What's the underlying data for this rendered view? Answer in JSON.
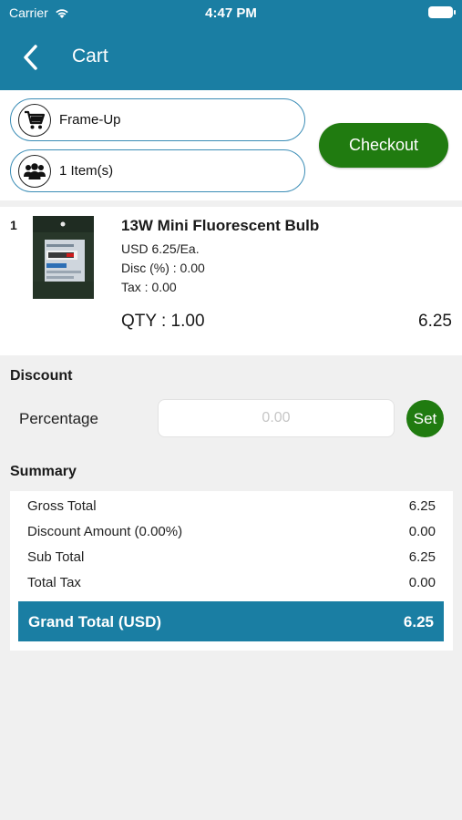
{
  "status_bar": {
    "carrier": "Carrier",
    "time": "4:47 PM"
  },
  "nav": {
    "title": "Cart"
  },
  "cart": {
    "store_name": "Frame-Up",
    "item_count": "1 Item(s)",
    "checkout_label": "Checkout"
  },
  "items": [
    {
      "index": "1",
      "name": "13W Mini Fluorescent Bulb",
      "unit_price": "USD 6.25/Ea.",
      "discount": "Disc (%) : 0.00",
      "tax": "Tax : 0.00",
      "qty": "QTY : 1.00",
      "total": "6.25"
    }
  ],
  "discount": {
    "title": "Discount",
    "percentage_label": "Percentage",
    "percentage_placeholder": "0.00",
    "set_label": "Set"
  },
  "summary": {
    "title": "Summary",
    "rows": [
      {
        "label": "Gross Total",
        "value": "6.25"
      },
      {
        "label": "Discount Amount (0.00%)",
        "value": "0.00"
      },
      {
        "label": "Sub Total",
        "value": "6.25"
      },
      {
        "label": "Total Tax",
        "value": "0.00"
      }
    ],
    "grand_total_label": "Grand Total (USD)",
    "grand_total_value": "6.25"
  },
  "colors": {
    "primary": "#1a7ea3",
    "accent_green": "#207b10",
    "pill_border": "#3b8db6"
  }
}
